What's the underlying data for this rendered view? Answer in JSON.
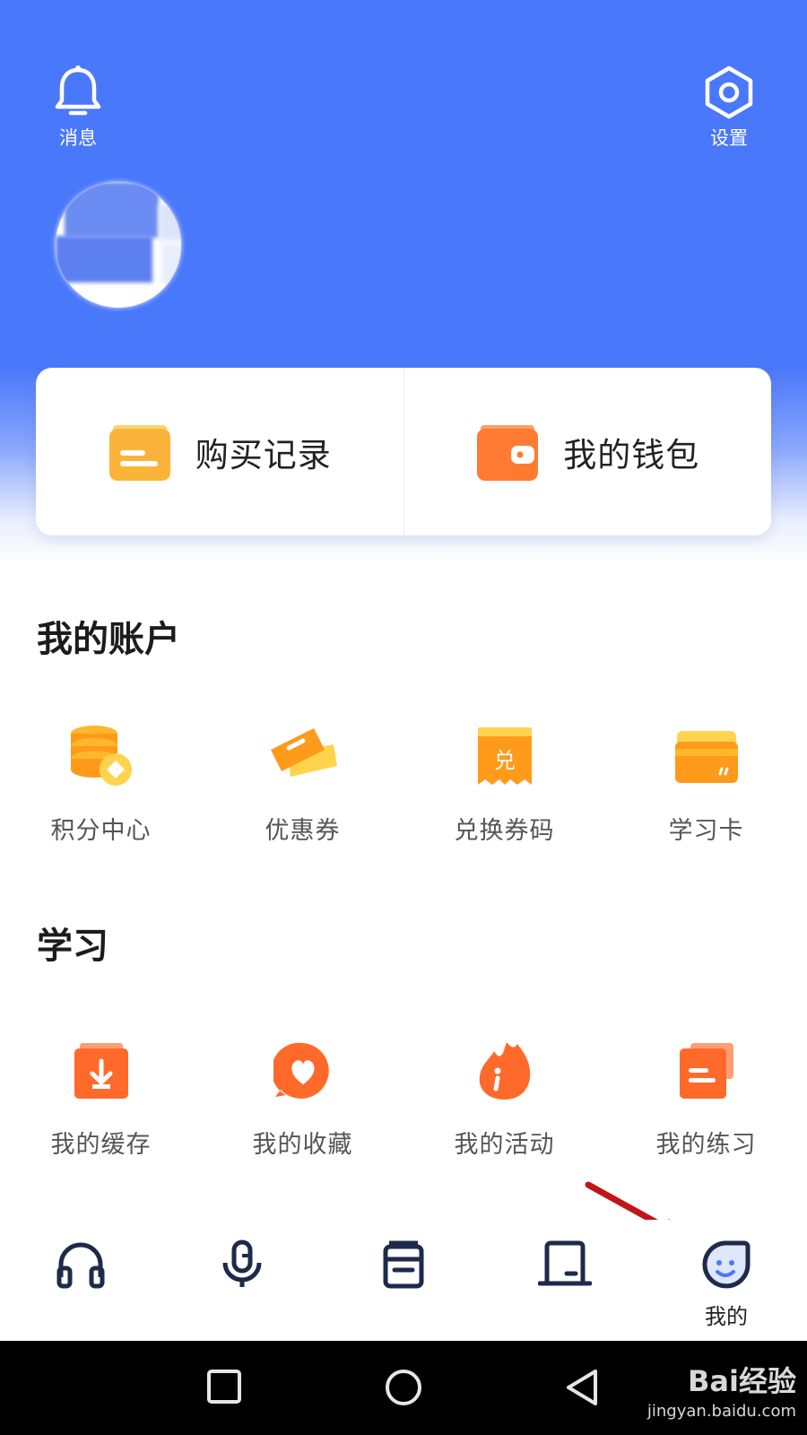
{
  "header": {
    "messages_label": "消息",
    "settings_label": "设置"
  },
  "quick_actions": [
    {
      "label": "购买记录",
      "icon": "purchase-record-icon",
      "color": "#fbb43a"
    },
    {
      "label": "我的钱包",
      "icon": "wallet-icon",
      "color": "#ff7a33"
    }
  ],
  "sections": {
    "account": {
      "title": "我的账户",
      "items": [
        {
          "label": "积分中心",
          "icon": "coins-icon"
        },
        {
          "label": "优惠券",
          "icon": "coupon-icon"
        },
        {
          "label": "兑换券码",
          "icon": "redeem-code-icon",
          "icon_text": "兑"
        },
        {
          "label": "学习卡",
          "icon": "study-card-icon"
        }
      ]
    },
    "study": {
      "title": "学习",
      "items": [
        {
          "label": "我的缓存",
          "icon": "download-cache-icon"
        },
        {
          "label": "我的收藏",
          "icon": "favorite-heart-icon"
        },
        {
          "label": "我的活动",
          "icon": "activity-flame-icon"
        },
        {
          "label": "我的练习",
          "icon": "practice-doc-icon"
        }
      ]
    }
  },
  "tabbar": {
    "items": [
      {
        "icon": "headphones-icon",
        "label": ""
      },
      {
        "icon": "microphone-icon",
        "label": ""
      },
      {
        "icon": "notebook-icon",
        "label": ""
      },
      {
        "icon": "laptop-icon",
        "label": ""
      },
      {
        "icon": "profile-face-icon",
        "label": "我的",
        "active": true
      }
    ]
  },
  "watermark": {
    "brand": "Bai经验",
    "url": "jingyan.baidu.com"
  },
  "colors": {
    "primary": "#4a78fb",
    "yellow": "#fbb43a",
    "orange": "#ff7a33",
    "accent_orange": "#ff6a2a",
    "annotation_red": "#c0151a"
  }
}
